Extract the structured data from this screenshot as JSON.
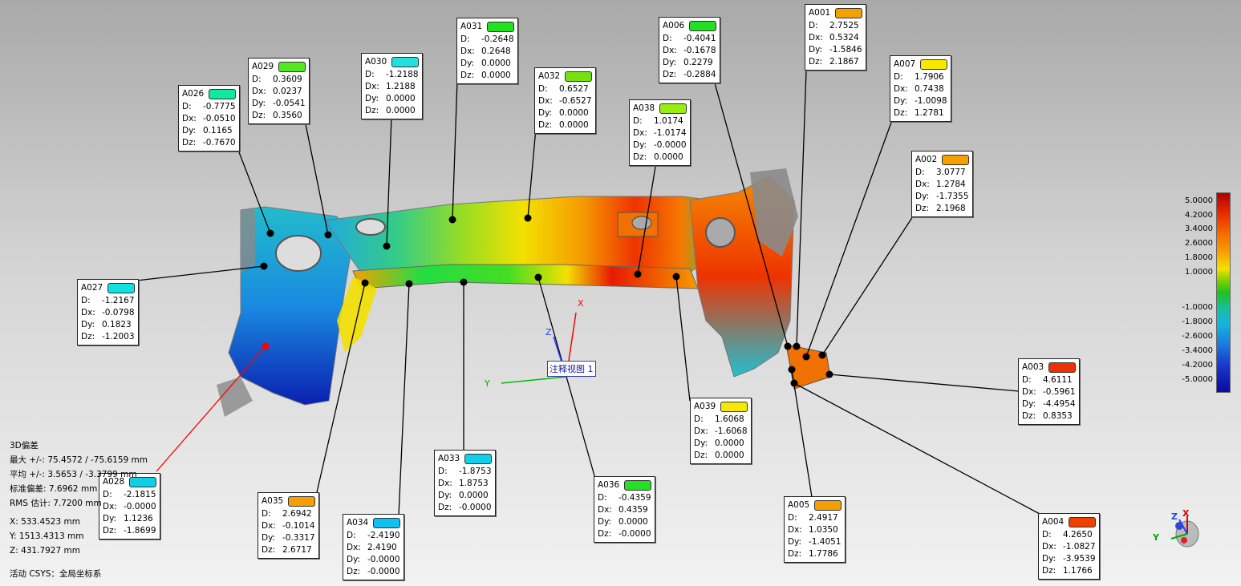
{
  "view_label": "注释视图 1",
  "stats": {
    "title": "3D偏差",
    "max": "最大 +/-: 75.4572 / -75.6159 mm",
    "avg": "平均 +/-: 3.5653 / -3.3799 mm",
    "std": "标准偏差: 7.6962 mm",
    "rms": "RMS 估计: 7.7200 mm",
    "x": "X:   533.4523 mm",
    "y": "Y:   1513.4313 mm",
    "z": "Z:   431.7927 mm",
    "csys": "活动 CSYS：全局坐标系"
  },
  "axes": {
    "x": "X",
    "y": "Y",
    "z": "Z"
  },
  "legend": [
    "5.0000",
    "4.2000",
    "3.4000",
    "2.6000",
    "1.8000",
    "1.0000",
    "-1.0000",
    "-1.8000",
    "-2.6000",
    "-3.4000",
    "-4.2000",
    "-5.0000"
  ],
  "colors": {
    "green": "#22dd22",
    "lime": "#99ee11",
    "cyan": "#11cfe6",
    "teal": "#11e0b0",
    "orange": "#f5a000",
    "yellow": "#f6e800",
    "red": "#f03000"
  },
  "labels": {
    "D": "D:",
    "Dx": "Dx:",
    "Dy": "Dy:",
    "Dz": "Dz:"
  },
  "callouts": [
    {
      "id": "A026",
      "color": "#11e8a0",
      "D": "-0.7775",
      "Dx": "-0.0510",
      "Dy": "0.1165",
      "Dz": "-0.7670"
    },
    {
      "id": "A029",
      "color": "#55e822",
      "D": "0.3609",
      "Dx": "0.0237",
      "Dy": "-0.0541",
      "Dz": "0.3560"
    },
    {
      "id": "A030",
      "color": "#22e0e0",
      "D": "-1.2188",
      "Dx": "1.2188",
      "Dy": "0.0000",
      "Dz": "0.0000"
    },
    {
      "id": "A031",
      "color": "#22e022",
      "D": "-0.2648",
      "Dx": "0.2648",
      "Dy": "0.0000",
      "Dz": "0.0000"
    },
    {
      "id": "A032",
      "color": "#77e011",
      "D": "0.6527",
      "Dx": "-0.6527",
      "Dy": "0.0000",
      "Dz": "0.0000"
    },
    {
      "id": "A006",
      "color": "#22e022",
      "D": "-0.4041",
      "Dx": "-0.1678",
      "Dy": "0.2279",
      "Dz": "-0.2884"
    },
    {
      "id": "A038",
      "color": "#99ee11",
      "D": "1.0174",
      "Dx": "-1.0174",
      "Dy": "-0.0000",
      "Dz": "0.0000"
    },
    {
      "id": "A001",
      "color": "#f5a000",
      "D": "2.7525",
      "Dx": "0.5324",
      "Dy": "-1.5846",
      "Dz": "2.1867"
    },
    {
      "id": "A007",
      "color": "#f6e800",
      "D": "1.7906",
      "Dx": "0.7438",
      "Dy": "-1.0098",
      "Dz": "1.2781"
    },
    {
      "id": "A002",
      "color": "#f5a000",
      "D": "3.0777",
      "Dx": "1.2784",
      "Dy": "-1.7355",
      "Dz": "2.1968"
    },
    {
      "id": "A027",
      "color": "#11e0e0",
      "D": "-1.2167",
      "Dx": "-0.0798",
      "Dy": "0.1823",
      "Dz": "-1.2003"
    },
    {
      "id": "A003",
      "color": "#f03000",
      "D": "4.6111",
      "Dx": "-0.5961",
      "Dy": "-4.4954",
      "Dz": "0.8353"
    },
    {
      "id": "A039",
      "color": "#f6e800",
      "D": "1.6068",
      "Dx": "-1.6068",
      "Dy": "0.0000",
      "Dz": "0.0000"
    },
    {
      "id": "A028",
      "color": "#11cfe6",
      "D": "-2.1815",
      "Dx": "-0.0000",
      "Dy": "1.1236",
      "Dz": "-1.8699"
    },
    {
      "id": "A033",
      "color": "#11cfe6",
      "D": "-1.8753",
      "Dx": "1.8753",
      "Dy": "0.0000",
      "Dz": "-0.0000"
    },
    {
      "id": "A036",
      "color": "#22e022",
      "D": "-0.4359",
      "Dx": "0.4359",
      "Dy": "0.0000",
      "Dz": "-0.0000"
    },
    {
      "id": "A035",
      "color": "#f5a000",
      "D": "2.6942",
      "Dx": "-0.1014",
      "Dy": "-0.3317",
      "Dz": "2.6717"
    },
    {
      "id": "A034",
      "color": "#11c0f0",
      "D": "-2.4190",
      "Dx": "2.4190",
      "Dy": "-0.0000",
      "Dz": "-0.0000"
    },
    {
      "id": "A005",
      "color": "#f5a000",
      "D": "2.4917",
      "Dx": "1.0350",
      "Dy": "-1.4051",
      "Dz": "1.7786"
    },
    {
      "id": "A004",
      "color": "#f04000",
      "D": "4.2650",
      "Dx": "-1.0827",
      "Dy": "-3.9539",
      "Dz": "1.1766"
    }
  ]
}
